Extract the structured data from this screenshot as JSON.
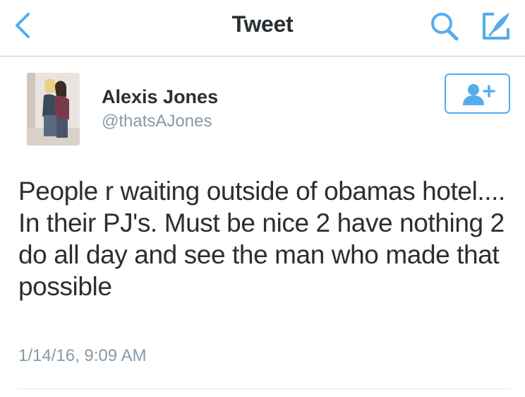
{
  "nav": {
    "title": "Tweet",
    "back_icon": "chevron-left-icon",
    "search_icon": "search-icon",
    "compose_icon": "compose-tweet-icon"
  },
  "tweet": {
    "author": {
      "name": "Alexis Jones",
      "handle": "@thatsAJones",
      "avatar": "avatar-photo"
    },
    "follow_button_icon": "add-user-icon",
    "text": "People r waiting outside of obamas hotel.... In their PJ's. Must be nice 2 have nothing 2 do all day and see the man who made that possible",
    "timestamp": "1/14/16, 9:09 AM"
  },
  "colors": {
    "accent": "#55acee",
    "text": "#292f33",
    "secondary_text": "#8899a6",
    "divider": "#c8c7cc"
  }
}
